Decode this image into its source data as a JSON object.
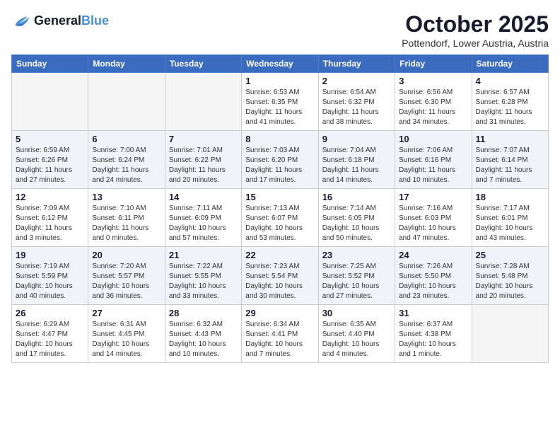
{
  "header": {
    "logo_line1": "General",
    "logo_line2": "Blue",
    "month": "October 2025",
    "location": "Pottendorf, Lower Austria, Austria"
  },
  "days_of_week": [
    "Sunday",
    "Monday",
    "Tuesday",
    "Wednesday",
    "Thursday",
    "Friday",
    "Saturday"
  ],
  "weeks": [
    [
      {
        "day": "",
        "info": ""
      },
      {
        "day": "",
        "info": ""
      },
      {
        "day": "",
        "info": ""
      },
      {
        "day": "1",
        "info": "Sunrise: 6:53 AM\nSunset: 6:35 PM\nDaylight: 11 hours\nand 41 minutes."
      },
      {
        "day": "2",
        "info": "Sunrise: 6:54 AM\nSunset: 6:32 PM\nDaylight: 11 hours\nand 38 minutes."
      },
      {
        "day": "3",
        "info": "Sunrise: 6:56 AM\nSunset: 6:30 PM\nDaylight: 11 hours\nand 34 minutes."
      },
      {
        "day": "4",
        "info": "Sunrise: 6:57 AM\nSunset: 6:28 PM\nDaylight: 11 hours\nand 31 minutes."
      }
    ],
    [
      {
        "day": "5",
        "info": "Sunrise: 6:59 AM\nSunset: 6:26 PM\nDaylight: 11 hours\nand 27 minutes."
      },
      {
        "day": "6",
        "info": "Sunrise: 7:00 AM\nSunset: 6:24 PM\nDaylight: 11 hours\nand 24 minutes."
      },
      {
        "day": "7",
        "info": "Sunrise: 7:01 AM\nSunset: 6:22 PM\nDaylight: 11 hours\nand 20 minutes."
      },
      {
        "day": "8",
        "info": "Sunrise: 7:03 AM\nSunset: 6:20 PM\nDaylight: 11 hours\nand 17 minutes."
      },
      {
        "day": "9",
        "info": "Sunrise: 7:04 AM\nSunset: 6:18 PM\nDaylight: 11 hours\nand 14 minutes."
      },
      {
        "day": "10",
        "info": "Sunrise: 7:06 AM\nSunset: 6:16 PM\nDaylight: 11 hours\nand 10 minutes."
      },
      {
        "day": "11",
        "info": "Sunrise: 7:07 AM\nSunset: 6:14 PM\nDaylight: 11 hours\nand 7 minutes."
      }
    ],
    [
      {
        "day": "12",
        "info": "Sunrise: 7:09 AM\nSunset: 6:12 PM\nDaylight: 11 hours\nand 3 minutes."
      },
      {
        "day": "13",
        "info": "Sunrise: 7:10 AM\nSunset: 6:11 PM\nDaylight: 11 hours\nand 0 minutes."
      },
      {
        "day": "14",
        "info": "Sunrise: 7:11 AM\nSunset: 6:09 PM\nDaylight: 10 hours\nand 57 minutes."
      },
      {
        "day": "15",
        "info": "Sunrise: 7:13 AM\nSunset: 6:07 PM\nDaylight: 10 hours\nand 53 minutes."
      },
      {
        "day": "16",
        "info": "Sunrise: 7:14 AM\nSunset: 6:05 PM\nDaylight: 10 hours\nand 50 minutes."
      },
      {
        "day": "17",
        "info": "Sunrise: 7:16 AM\nSunset: 6:03 PM\nDaylight: 10 hours\nand 47 minutes."
      },
      {
        "day": "18",
        "info": "Sunrise: 7:17 AM\nSunset: 6:01 PM\nDaylight: 10 hours\nand 43 minutes."
      }
    ],
    [
      {
        "day": "19",
        "info": "Sunrise: 7:19 AM\nSunset: 5:59 PM\nDaylight: 10 hours\nand 40 minutes."
      },
      {
        "day": "20",
        "info": "Sunrise: 7:20 AM\nSunset: 5:57 PM\nDaylight: 10 hours\nand 36 minutes."
      },
      {
        "day": "21",
        "info": "Sunrise: 7:22 AM\nSunset: 5:55 PM\nDaylight: 10 hours\nand 33 minutes."
      },
      {
        "day": "22",
        "info": "Sunrise: 7:23 AM\nSunset: 5:54 PM\nDaylight: 10 hours\nand 30 minutes."
      },
      {
        "day": "23",
        "info": "Sunrise: 7:25 AM\nSunset: 5:52 PM\nDaylight: 10 hours\nand 27 minutes."
      },
      {
        "day": "24",
        "info": "Sunrise: 7:26 AM\nSunset: 5:50 PM\nDaylight: 10 hours\nand 23 minutes."
      },
      {
        "day": "25",
        "info": "Sunrise: 7:28 AM\nSunset: 5:48 PM\nDaylight: 10 hours\nand 20 minutes."
      }
    ],
    [
      {
        "day": "26",
        "info": "Sunrise: 6:29 AM\nSunset: 4:47 PM\nDaylight: 10 hours\nand 17 minutes."
      },
      {
        "day": "27",
        "info": "Sunrise: 6:31 AM\nSunset: 4:45 PM\nDaylight: 10 hours\nand 14 minutes."
      },
      {
        "day": "28",
        "info": "Sunrise: 6:32 AM\nSunset: 4:43 PM\nDaylight: 10 hours\nand 10 minutes."
      },
      {
        "day": "29",
        "info": "Sunrise: 6:34 AM\nSunset: 4:41 PM\nDaylight: 10 hours\nand 7 minutes."
      },
      {
        "day": "30",
        "info": "Sunrise: 6:35 AM\nSunset: 4:40 PM\nDaylight: 10 hours\nand 4 minutes."
      },
      {
        "day": "31",
        "info": "Sunrise: 6:37 AM\nSunset: 4:38 PM\nDaylight: 10 hours\nand 1 minute."
      },
      {
        "day": "",
        "info": ""
      }
    ]
  ]
}
